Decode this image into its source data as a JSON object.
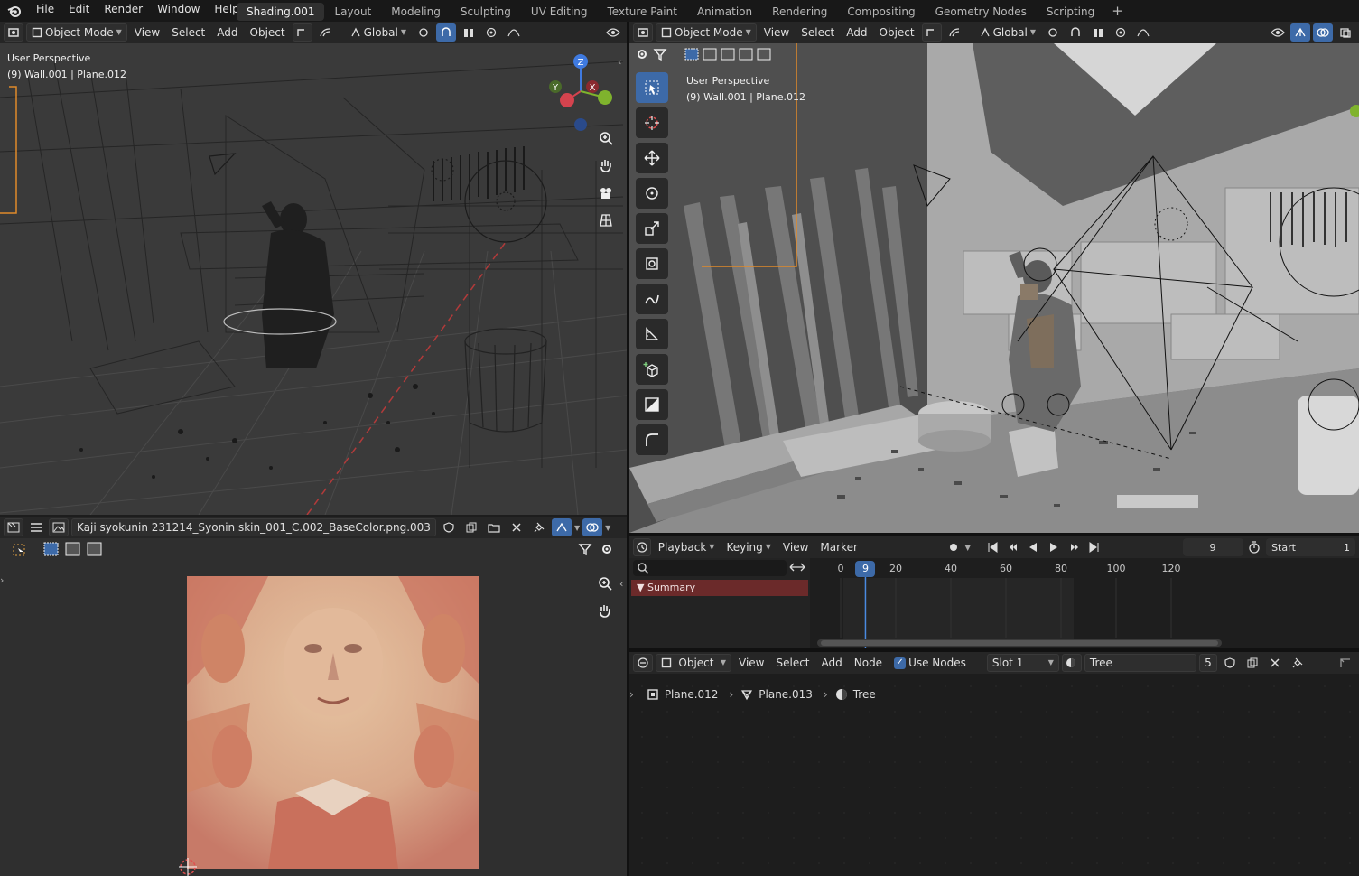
{
  "menubar": {
    "items": [
      "File",
      "Edit",
      "Render",
      "Window",
      "Help"
    ],
    "workspaces": [
      "Shading.001",
      "Layout",
      "Modeling",
      "Sculpting",
      "UV Editing",
      "Texture Paint",
      "Animation",
      "Rendering",
      "Compositing",
      "Geometry Nodes",
      "Scripting"
    ],
    "active_workspace": "Shading.001"
  },
  "viewport_left": {
    "mode": "Object Mode",
    "menus": [
      "View",
      "Select",
      "Add",
      "Object"
    ],
    "transform_orientation": "Global",
    "info_line1": "User Perspective",
    "info_line2": "(9) Wall.001 | Plane.012",
    "gizmo": {
      "x": "X",
      "y": "Y",
      "z": "Z"
    },
    "shading": "wireframe"
  },
  "viewport_right": {
    "mode": "Object Mode",
    "menus": [
      "View",
      "Select",
      "Add",
      "Object"
    ],
    "transform_orientation": "Global",
    "info_line1": "User Perspective",
    "info_line2": "(9) Wall.001 | Plane.012",
    "shading": "solid"
  },
  "image_editor": {
    "image_name": "Kaji syokunin 231214_Syonin skin_001_C.002_BaseColor.png.003"
  },
  "timeline": {
    "menus": [
      "Playback",
      "Keying",
      "View",
      "Marker"
    ],
    "current_frame": "9",
    "start_label": "Start",
    "start_value": "1",
    "ticks": [
      "0",
      "20",
      "40",
      "60",
      "80",
      "100",
      "120"
    ],
    "summary_label": "Summary"
  },
  "node_editor": {
    "object_mode": "Object",
    "menus": [
      "View",
      "Select",
      "Add",
      "Node"
    ],
    "use_nodes_label": "Use Nodes",
    "use_nodes": true,
    "slot": "Slot 1",
    "material_name": "Tree",
    "material_users": "5",
    "breadcrumb": [
      "Plane.012",
      "Plane.013",
      "Tree"
    ]
  },
  "colors": {
    "accent": "#3d6aa8",
    "selected_orange": "#e08a2a",
    "axis_x": "#d4434e",
    "axis_y": "#7fb32d",
    "axis_z": "#3f7ae0"
  }
}
